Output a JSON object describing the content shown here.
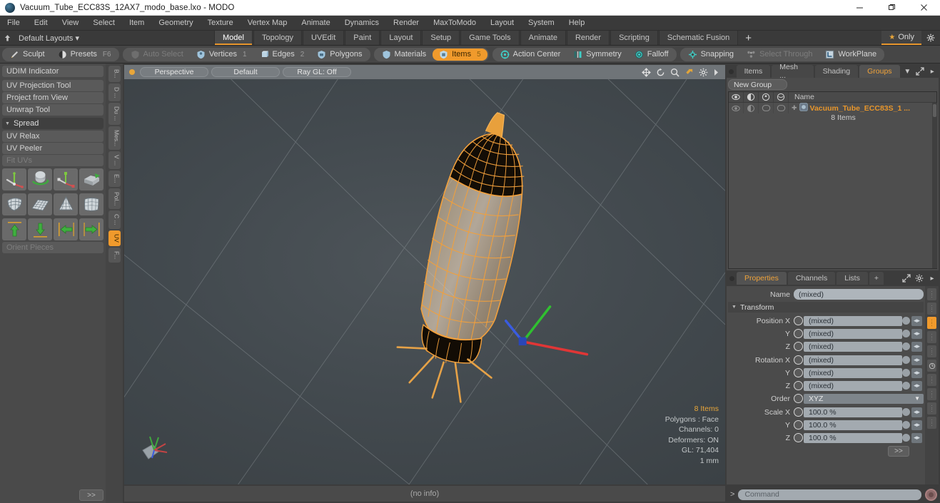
{
  "titlebar": {
    "title": "Vacuum_Tube_ECC83S_12AX7_modo_base.lxo - MODO",
    "logo_icon": "modo-logo-icon",
    "minimize_icon": "minimize-icon",
    "maximize_icon": "maximize-icon",
    "close_icon": "close-icon"
  },
  "menu": {
    "items": [
      "File",
      "Edit",
      "View",
      "Select",
      "Item",
      "Geometry",
      "Texture",
      "Vertex Map",
      "Animate",
      "Dynamics",
      "Render",
      "MaxToModo",
      "Layout",
      "System",
      "Help"
    ]
  },
  "layoutbar": {
    "pin_icon": "pin-icon",
    "layouts_label": "Default Layouts",
    "tabs": [
      {
        "label": "Model",
        "active": true
      },
      {
        "label": "Topology",
        "active": false
      },
      {
        "label": "UVEdit",
        "active": false
      },
      {
        "label": "Paint",
        "active": false
      },
      {
        "label": "Layout",
        "active": false
      },
      {
        "label": "Setup",
        "active": false
      },
      {
        "label": "Game Tools",
        "active": false
      },
      {
        "label": "Animate",
        "active": false
      },
      {
        "label": "Render",
        "active": false
      },
      {
        "label": "Scripting",
        "active": false
      },
      {
        "label": "Schematic Fusion",
        "active": false
      }
    ],
    "add_label": "+",
    "only_label": "Only",
    "star_icon": "star-icon",
    "gear_icon": "gear-icon"
  },
  "modebar": {
    "group1": [
      {
        "label": "Sculpt",
        "icon": "brush-icon",
        "state": "normal",
        "num": ""
      },
      {
        "label": "Presets",
        "icon": "sphere-icon",
        "state": "normal",
        "num": "F6"
      }
    ],
    "group2": [
      {
        "label": "Auto Select",
        "icon": "shield-grey-icon",
        "state": "disabled",
        "num": ""
      },
      {
        "label": "Vertices",
        "icon": "vertices-icon",
        "state": "normal",
        "num": "1"
      },
      {
        "label": "Edges",
        "icon": "edges-icon",
        "state": "normal",
        "num": "2"
      },
      {
        "label": "Polygons",
        "icon": "polygons-icon",
        "state": "normal",
        "num": ""
      }
    ],
    "group3": [
      {
        "label": "Materials",
        "icon": "materials-icon",
        "state": "normal",
        "num": ""
      },
      {
        "label": "Items",
        "icon": "items-icon",
        "state": "active",
        "num": "5"
      }
    ],
    "group4": [
      {
        "label": "Action Center",
        "icon": "action-center-icon",
        "state": "normal",
        "num": ""
      },
      {
        "label": "Symmetry",
        "icon": "symmetry-icon",
        "state": "normal",
        "num": ""
      },
      {
        "label": "Falloff",
        "icon": "falloff-icon",
        "state": "normal",
        "num": ""
      }
    ],
    "group5": [
      {
        "label": "Snapping",
        "icon": "snapping-icon",
        "state": "normal",
        "num": ""
      },
      {
        "label": "Select Through",
        "icon": "select-through-icon",
        "state": "disabled",
        "num": ""
      },
      {
        "label": "WorkPlane",
        "icon": "workplane-icon",
        "state": "normal",
        "num": ""
      }
    ]
  },
  "leftpanel": {
    "rows": [
      {
        "label": "UDIM Indicator",
        "dim": false
      },
      {
        "label": "UV Projection Tool",
        "dim": false
      },
      {
        "label": "Project from View",
        "dim": false
      },
      {
        "label": "Unwrap Tool",
        "dim": false
      }
    ],
    "section_label": "Spread",
    "rows2": [
      {
        "label": "UV Relax",
        "dim": false
      },
      {
        "label": "UV Peeler",
        "dim": false
      },
      {
        "label": "Fit UVs",
        "dim": true
      }
    ],
    "icons_row1": [
      "uv-move-icon",
      "uv-rotate-icon",
      "uv-scale-icon",
      "uv-flip-icon"
    ],
    "icons_row2": [
      "uv-quad-icon",
      "uv-grid-icon",
      "uv-cone-icon",
      "uv-sphere-grid-icon"
    ],
    "icons_row3": [
      "arrow-up-icon",
      "arrow-down-icon",
      "arrow-left-icon",
      "arrow-right-icon"
    ],
    "orient_label": "Orient Pieces",
    "more_label": ">>",
    "vtabs": [
      {
        "label": "B...",
        "active": false
      },
      {
        "label": "D ...",
        "active": false
      },
      {
        "label": "Du ...",
        "active": false
      },
      {
        "label": "Mes...",
        "active": false
      },
      {
        "label": "V ...",
        "active": false
      },
      {
        "label": "E...",
        "active": false
      },
      {
        "label": "Pol...",
        "active": false
      },
      {
        "label": "C ...",
        "active": false
      },
      {
        "label": "UV",
        "active": true
      },
      {
        "label": "F...",
        "active": false
      }
    ]
  },
  "viewport": {
    "dot_icon": "viewport-dot-icon",
    "pills": [
      "Perspective",
      "Default",
      "Ray GL: Off"
    ],
    "header_icons": [
      "pan-icon",
      "rotate-icon",
      "zoom-icon",
      "fit-icon",
      "gear-icon",
      "chevron-right-icon"
    ],
    "info": {
      "items": "8 Items",
      "polygons": "Polygons : Face",
      "channels": "Channels: 0",
      "deformers": "Deformers: ON",
      "gl": "GL: 71,404",
      "scale": "1 mm"
    },
    "axis_gizmo_icon": "axis-gizmo-icon",
    "status": "(no info)"
  },
  "right": {
    "top_tabs": [
      {
        "label": "Items",
        "active": false
      },
      {
        "label": "Mesh ...",
        "active": false
      },
      {
        "label": "Shading",
        "active": false
      },
      {
        "label": "Groups",
        "active": true
      }
    ],
    "top_tab_icons": [
      "chevron-down-icon",
      "expand-icon",
      "chevron-right-icon"
    ],
    "new_group_label": "New Group",
    "table": {
      "head_icons": [
        "eye-icon",
        "shade-icon",
        "render-icon",
        "wire-icon"
      ],
      "name_header": "Name",
      "rows": [
        {
          "group_icon": "group-item-icon",
          "name": "Vacuum_Tube_ECC83S_1 ...",
          "count": "8 Items",
          "toggle_icons": [
            "eye-off-icon",
            "shade-icon",
            "render-off-icon",
            "wire-off-icon"
          ]
        }
      ]
    },
    "prop_tabs": [
      {
        "label": "Properties",
        "active": true
      },
      {
        "label": "Channels",
        "active": false
      },
      {
        "label": "Lists",
        "active": false
      },
      {
        "label": "+",
        "active": false
      }
    ],
    "prop_tab_icons": [
      "expand-icon",
      "gear-icon",
      "chevron-right-icon"
    ],
    "properties": {
      "name_label": "Name",
      "name_value": "(mixed)",
      "transform_label": "Transform",
      "fields": [
        {
          "label": "Position X",
          "value": "(mixed)",
          "type": "field"
        },
        {
          "label": "Y",
          "value": "(mixed)",
          "type": "field"
        },
        {
          "label": "Z",
          "value": "(mixed)",
          "type": "field"
        },
        {
          "label": "Rotation X",
          "value": "(mixed)",
          "type": "field"
        },
        {
          "label": "Y",
          "value": "(mixed)",
          "type": "field"
        },
        {
          "label": "Z",
          "value": "(mixed)",
          "type": "field"
        },
        {
          "label": "Order",
          "value": "XYZ",
          "type": "select"
        },
        {
          "label": "Scale X",
          "value": "100.0 %",
          "type": "field"
        },
        {
          "label": "Y",
          "value": "100.0 %",
          "type": "field"
        },
        {
          "label": "Z",
          "value": "100.0 %",
          "type": "field"
        }
      ],
      "more_label": ">>"
    }
  },
  "command": {
    "prompt": ">",
    "placeholder": "Command",
    "record_icon": "record-icon"
  },
  "colors": {
    "accent": "#f09a2c",
    "group_name": "#e8962b",
    "field_bg": "#a3aab0",
    "panel_bg": "#4b4b4b",
    "toolbar_bg": "#464646"
  }
}
